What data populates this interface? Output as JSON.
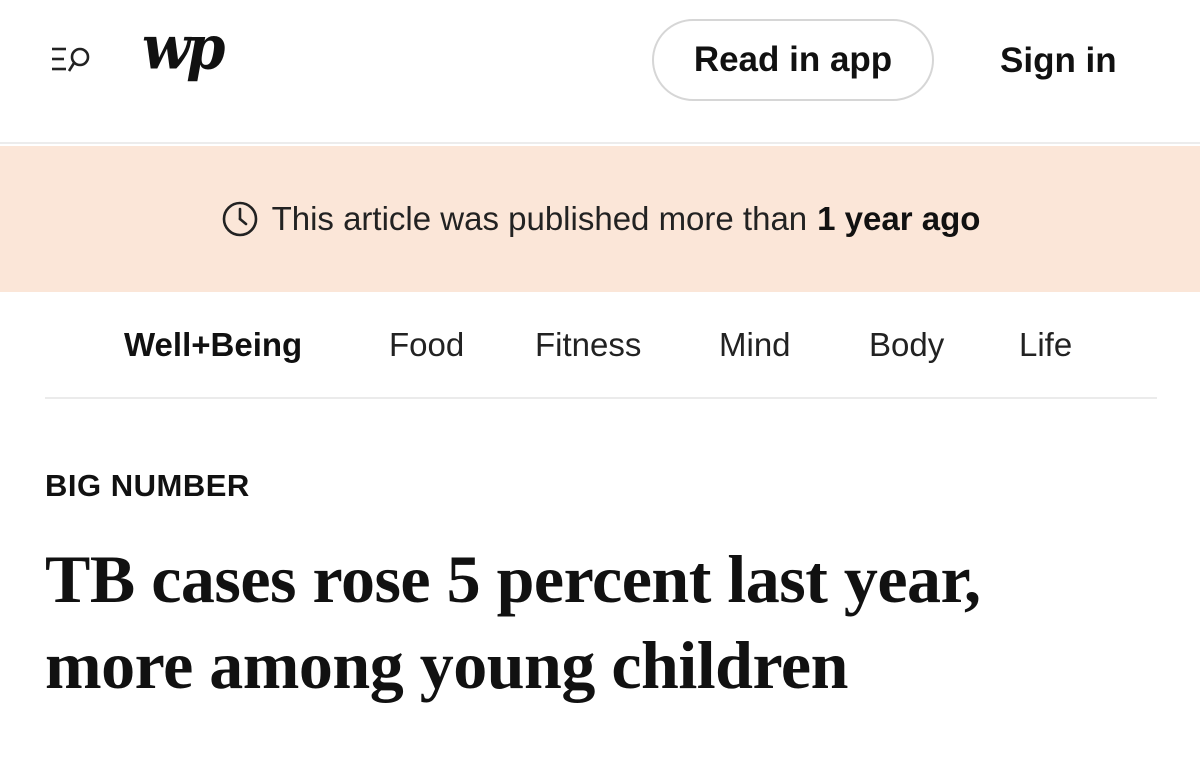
{
  "header": {
    "logo_text": "wp",
    "read_in_app_label": "Read in app",
    "sign_in_label": "Sign in"
  },
  "notice": {
    "text": "This article was published more than",
    "emphasis": "1 year ago",
    "background_color": "#fbe6d8"
  },
  "section_nav": {
    "items": [
      {
        "label": "Well+Being",
        "active": true
      },
      {
        "label": "Food"
      },
      {
        "label": "Fitness"
      },
      {
        "label": "Mind"
      },
      {
        "label": "Body"
      },
      {
        "label": "Life"
      }
    ]
  },
  "article": {
    "kicker": "BIG NUMBER",
    "headline_line1": "TB cases rose 5 percent last year,",
    "headline_line2": "more among young children"
  },
  "icons": {
    "menu_search": "menu-search-icon",
    "clock": "clock-icon"
  }
}
